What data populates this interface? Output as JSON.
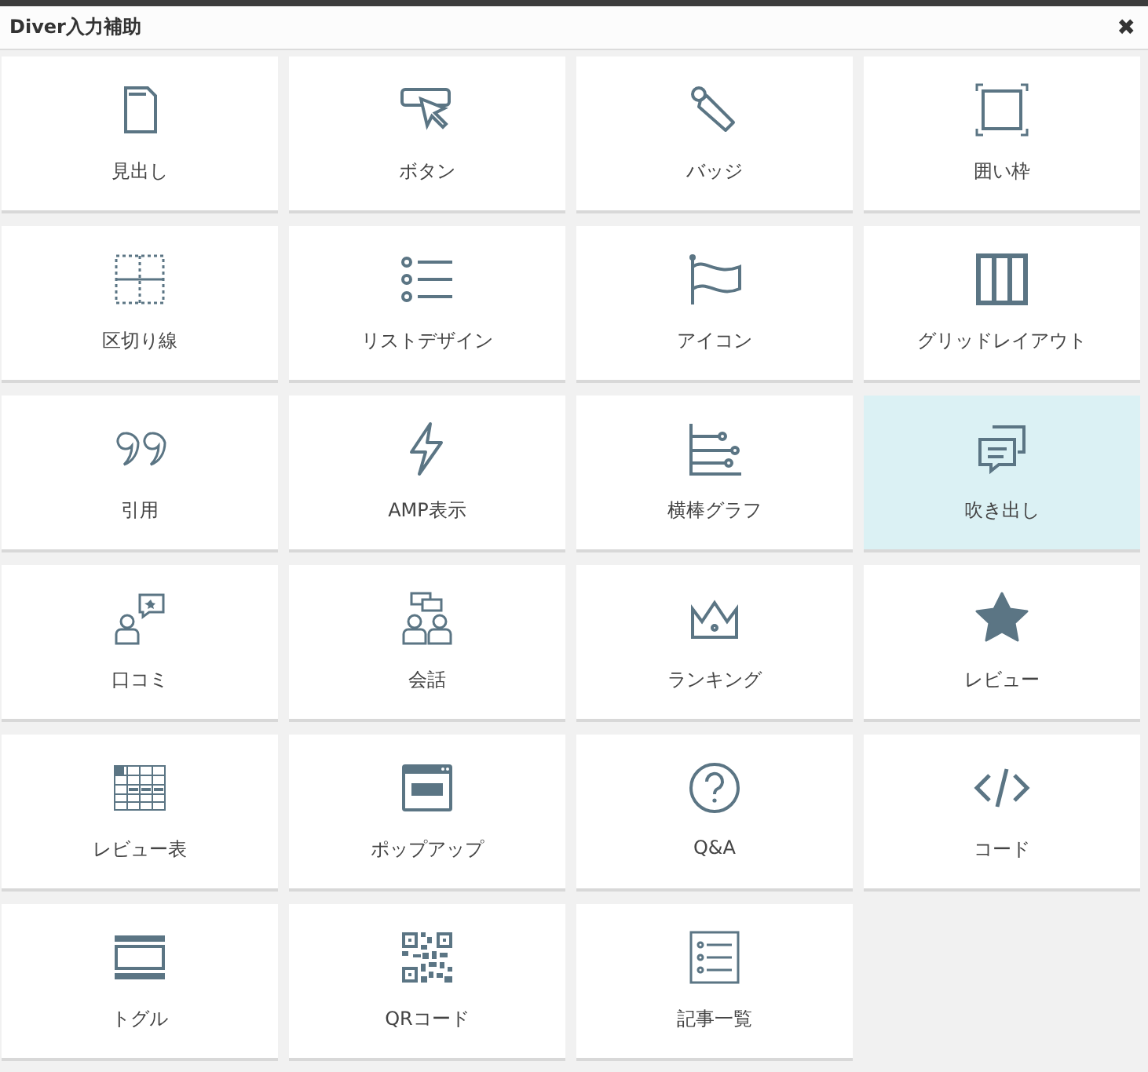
{
  "window": {
    "title": "Diver入力補助",
    "close": "✖"
  },
  "tiles": [
    {
      "label": "見出し",
      "kind": "document",
      "selected": false
    },
    {
      "label": "ボタン",
      "kind": "cursor",
      "selected": false
    },
    {
      "label": "バッジ",
      "kind": "tag",
      "selected": false
    },
    {
      "label": "囲い枠",
      "kind": "frame",
      "selected": false
    },
    {
      "label": "区切り線",
      "kind": "dashgrid",
      "selected": false
    },
    {
      "label": "リストデザイン",
      "kind": "list",
      "selected": false
    },
    {
      "label": "アイコン",
      "kind": "flag",
      "selected": false
    },
    {
      "label": "グリッドレイアウト",
      "kind": "columns",
      "selected": false
    },
    {
      "label": "引用",
      "kind": "quote",
      "selected": false
    },
    {
      "label": "AMP表示",
      "kind": "bolt",
      "selected": false
    },
    {
      "label": "横棒グラフ",
      "kind": "barchart",
      "selected": false
    },
    {
      "label": "吹き出し",
      "kind": "bubbles",
      "selected": true
    },
    {
      "label": "口コミ",
      "kind": "review",
      "selected": false
    },
    {
      "label": "会話",
      "kind": "people",
      "selected": false
    },
    {
      "label": "ランキング",
      "kind": "crown",
      "selected": false
    },
    {
      "label": "レビュー",
      "kind": "star",
      "selected": false
    },
    {
      "label": "レビュー表",
      "kind": "table",
      "selected": false
    },
    {
      "label": "ポップアップ",
      "kind": "popup",
      "selected": false
    },
    {
      "label": "Q&A",
      "kind": "question",
      "selected": false
    },
    {
      "label": "コード",
      "kind": "code",
      "selected": false
    },
    {
      "label": "トグル",
      "kind": "toggle",
      "selected": false
    },
    {
      "label": "QRコード",
      "kind": "qr",
      "selected": false
    },
    {
      "label": "記事一覧",
      "kind": "articles",
      "selected": false
    }
  ]
}
